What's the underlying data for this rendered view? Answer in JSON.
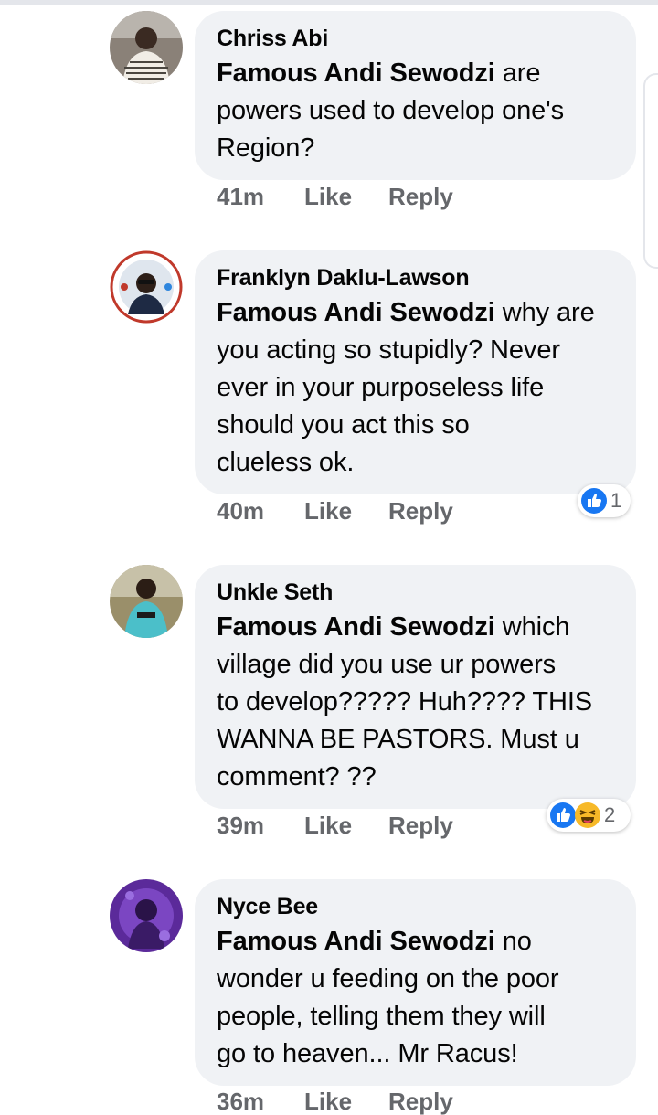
{
  "colors": {
    "bubble": "#f0f2f5",
    "text": "#050505",
    "meta": "#65676b",
    "like_blue": "#1877f2",
    "haha_yellow": "#f7b928"
  },
  "comments": [
    {
      "author": "Chriss Abi",
      "mention": "Famous Andi Sewodzi",
      "lines": [
        "are",
        "powers used to develop one's",
        "Region?"
      ],
      "time": "41m",
      "like_label": "Like",
      "reply_label": "Reply",
      "reactions": null
    },
    {
      "author": "Franklyn Daklu-Lawson",
      "mention": "Famous Andi Sewodzi",
      "lines": [
        "why are",
        "you acting so stupidly? Never",
        "ever in your purposeless life",
        "should you act this so",
        "clueless ok."
      ],
      "time": "40m",
      "like_label": "Like",
      "reply_label": "Reply",
      "reactions": {
        "icons": [
          "like-icon"
        ],
        "count": "1"
      }
    },
    {
      "author": "Unkle Seth",
      "mention": "Famous Andi Sewodzi",
      "lines": [
        "which",
        "village did you use ur powers",
        "to develop????? Huh???? THIS",
        "WANNA BE PASTORS. Must u",
        "comment? ??"
      ],
      "time": "39m",
      "like_label": "Like",
      "reply_label": "Reply",
      "reactions": {
        "icons": [
          "like-icon",
          "haha-icon"
        ],
        "count": "2"
      }
    },
    {
      "author": "Nyce Bee",
      "mention": "Famous Andi Sewodzi",
      "lines": [
        "no",
        "wonder u feeding on the poor",
        "people, telling them they will",
        "go to heaven... Mr Racus!"
      ],
      "time": "36m",
      "like_label": "Like",
      "reply_label": "Reply",
      "reactions": null
    }
  ]
}
